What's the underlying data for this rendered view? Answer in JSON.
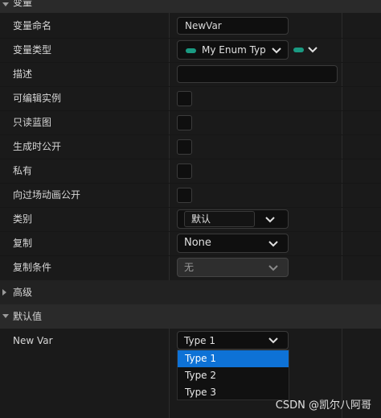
{
  "categories": {
    "variable": "变量",
    "advanced": "高级",
    "default_value": "默认值"
  },
  "rows": {
    "var_name_label": "变量命名",
    "var_name_value": "NewVar",
    "var_type_label": "变量类型",
    "var_type_value": "My Enum Type",
    "description_label": "描述",
    "description_value": "",
    "instance_editable_label": "可编辑实例",
    "readonly_bp_label": "只读蓝图",
    "expose_spawn_label": "生成时公开",
    "private_label": "私有",
    "expose_cinematics_label": "向过场动画公开",
    "category_label": "类别",
    "category_value": "默认",
    "replication_label": "复制",
    "replication_value": "None",
    "rep_condition_label": "复制条件",
    "rep_condition_value": "无",
    "new_var_label": "New Var",
    "new_var_value": "Type 1"
  },
  "enum_menu": {
    "options": [
      "Type 1",
      "Type 2",
      "Type 3"
    ],
    "selected": "Type 1"
  },
  "checkboxes": {
    "instance_editable": false,
    "readonly_bp": false,
    "expose_spawn": false,
    "private": false,
    "expose_cinematics": false
  },
  "colors": {
    "background": "#1a1a1a",
    "category_bar": "#2a2a2a",
    "enum_pill": "#1a9a82",
    "menu_highlight": "#0e72d6"
  },
  "icons": {
    "type_pill": "enum-type-pill-icon",
    "chevron": "chevron-down-icon",
    "expand": "caret-down-icon",
    "collapse": "caret-right-icon"
  },
  "watermark": "CSDN @凯尔八阿哥"
}
